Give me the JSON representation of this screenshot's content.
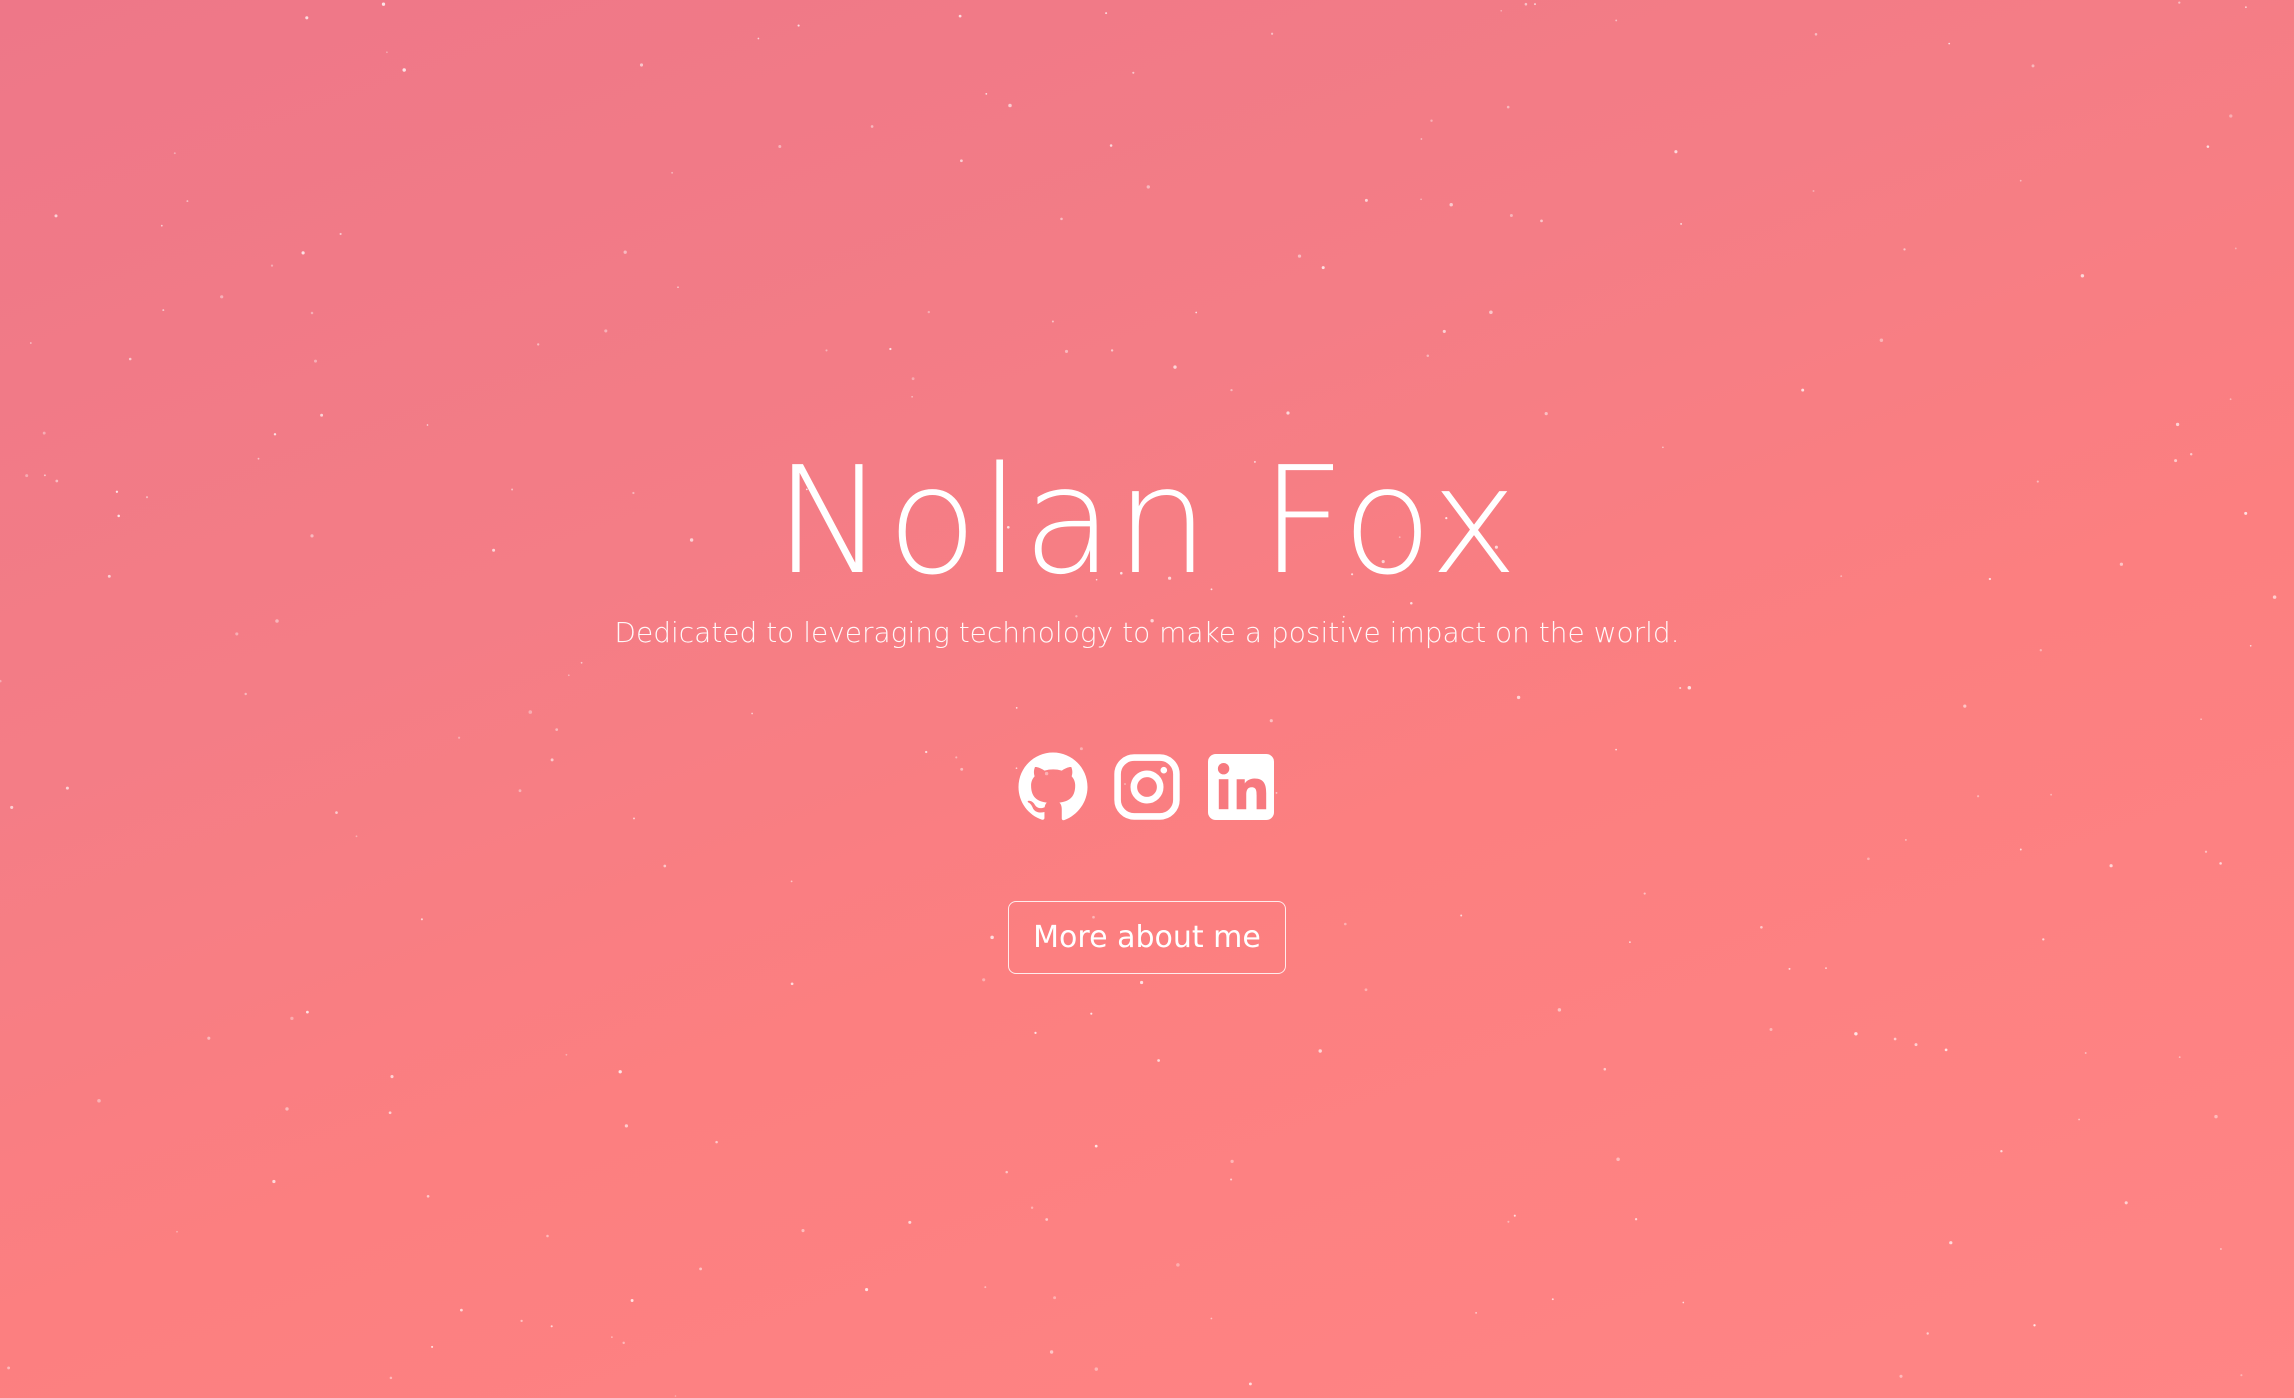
{
  "hero": {
    "name": "Nolan Fox",
    "tagline": "Dedicated to leveraging technology to make a positive impact on the world."
  },
  "social": [
    {
      "icon": "github-icon",
      "label": "GitHub"
    },
    {
      "icon": "instagram-icon",
      "label": "Instagram"
    },
    {
      "icon": "linkedin-icon",
      "label": "LinkedIn"
    }
  ],
  "cta": {
    "label": "More about me"
  },
  "colors": {
    "gradient_start": "#ee7788",
    "gradient_end": "#ff8585",
    "foreground": "#ffffff"
  }
}
